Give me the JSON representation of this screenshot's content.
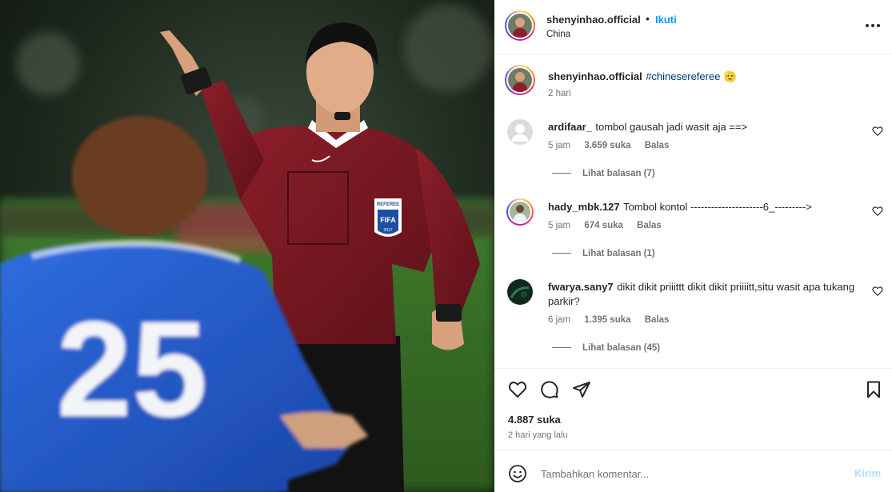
{
  "post": {
    "author": "shenyinhao.official",
    "separator": "•",
    "follow_label": "Ikuti",
    "location": "China",
    "more_icon": "more-horizontal-icon"
  },
  "caption": {
    "author": "shenyinhao.official",
    "hashtag": "#chinesereferee",
    "emoji": "🫡",
    "time": "2 hari"
  },
  "comments": [
    {
      "user": "ardifaar_",
      "text": "tombol gausah jadi wasit aja ==>",
      "time": "5 jam",
      "likes": "3.659 suka",
      "reply_label": "Balas",
      "view_replies": "Lihat balasan (7)"
    },
    {
      "user": "hady_mbk.127",
      "text": "Tombol kontol ---------------------6_--------->",
      "time": "5 jam",
      "likes": "674 suka",
      "reply_label": "Balas",
      "view_replies": "Lihat balasan (1)"
    },
    {
      "user": "fwarya.sany7",
      "text": "dikit dikit priiittt dikit dikit priiiitt,situ wasit apa tukang parkir?",
      "time": "6 jam",
      "likes": "1.395 suka",
      "reply_label": "Balas",
      "view_replies": "Lihat balasan (45)"
    }
  ],
  "actions": {
    "likes": "4.887 suka",
    "posted": "2 hari yang lalu"
  },
  "composer": {
    "placeholder": "Tambahkan komentar...",
    "send_label": "Kirim"
  },
  "photo": {
    "jersey_number": "25",
    "badge_top": "REFEREE",
    "badge_main": "FIFA",
    "badge_year": "2017"
  },
  "colors": {
    "follow": "#0095f6",
    "hashtag": "#00376b",
    "send_disabled": "#b3dbff",
    "meta": "#737373"
  }
}
